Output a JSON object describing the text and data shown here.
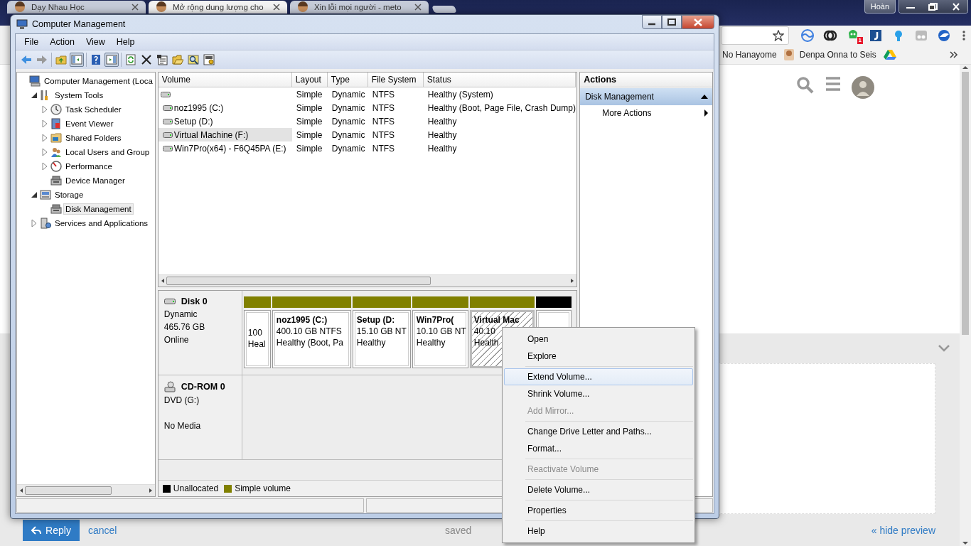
{
  "browser": {
    "tabs": [
      {
        "title": "Dạy Nhau Học",
        "selected": false
      },
      {
        "title": "Mở rộng dung lượng cho",
        "selected": true
      },
      {
        "title": "Xin lỗi mọi người - meto",
        "selected": false
      }
    ],
    "profile": "Hoàn",
    "extensions": [
      {
        "kind": "wave"
      },
      {
        "kind": "rings"
      },
      {
        "kind": "alien",
        "badge": "1"
      },
      {
        "kind": "bookmark"
      },
      {
        "kind": "bulb"
      },
      {
        "kind": "glasses"
      },
      {
        "kind": "globe"
      }
    ],
    "bookmarks": [
      {
        "kind": "text",
        "label": "No Hanayome"
      },
      {
        "kind": "image",
        "label": "Denpa Onna to Seis"
      },
      {
        "kind": "drive"
      }
    ],
    "page": {
      "reply_button": "Reply",
      "cancel_link": "cancel",
      "save_status": "saved",
      "hide_preview_link": "« hide preview"
    }
  },
  "window": {
    "title": "Computer Management",
    "menu": [
      "File",
      "Action",
      "View",
      "Help"
    ],
    "toolbar": [
      [
        {
          "kind": "back",
          "pressed": false
        },
        {
          "kind": "forward",
          "pressed": false
        }
      ],
      [
        {
          "kind": "up",
          "pressed": false
        },
        {
          "kind": "tree",
          "pressed": true
        }
      ],
      [
        {
          "kind": "help",
          "pressed": false
        },
        {
          "kind": "pane",
          "pressed": true
        }
      ],
      [
        {
          "kind": "refresh",
          "pressed": false
        },
        {
          "kind": "delete",
          "pressed": false
        },
        {
          "kind": "properties",
          "pressed": false
        },
        {
          "kind": "open",
          "pressed": false
        },
        {
          "kind": "search",
          "pressed": false
        },
        {
          "kind": "settings",
          "pressed": false
        }
      ]
    ],
    "tree": [
      {
        "label": "Computer Management (Loca",
        "kind": "computer",
        "selected": false,
        "children": [
          {
            "label": "System Tools",
            "kind": "tools",
            "expanded": true,
            "selected": false,
            "children": [
              {
                "label": "Task Scheduler",
                "kind": "clock",
                "expanded": false,
                "selected": false
              },
              {
                "label": "Event Viewer",
                "kind": "viewer",
                "expanded": false,
                "selected": false
              },
              {
                "label": "Shared Folders",
                "kind": "folder",
                "expanded": false,
                "selected": false
              },
              {
                "label": "Local Users and Group",
                "kind": "users",
                "expanded": false,
                "selected": false
              },
              {
                "label": "Performance",
                "kind": "gauge",
                "expanded": false,
                "selected": false
              },
              {
                "label": "Device Manager",
                "kind": "device",
                "selected": false
              }
            ]
          },
          {
            "label": "Storage",
            "kind": "storage",
            "expanded": true,
            "selected": false,
            "children": [
              {
                "label": "Disk Management",
                "kind": "device",
                "selected": true
              }
            ]
          },
          {
            "label": "Services and Applications",
            "kind": "services",
            "expanded": false,
            "selected": false
          }
        ]
      }
    ],
    "volumes": {
      "columns": [
        "Volume",
        "Layout",
        "Type",
        "File System",
        "Status"
      ],
      "rows": [
        {
          "layout": "Simple",
          "type": "Dynamic",
          "file_system": "NTFS",
          "status": "Healthy (System)",
          "selected": false
        },
        {
          "volume": "noz1995 (C:)",
          "layout": "Simple",
          "type": "Dynamic",
          "file_system": "NTFS",
          "status": "Healthy (Boot, Page File, Crash Dump)",
          "selected": false
        },
        {
          "volume": "Setup (D:)",
          "layout": "Simple",
          "type": "Dynamic",
          "file_system": "NTFS",
          "status": "Healthy",
          "selected": false
        },
        {
          "volume": "Virtual Machine (F:)",
          "layout": "Simple",
          "type": "Dynamic",
          "file_system": "NTFS",
          "status": "Healthy",
          "selected": true
        },
        {
          "volume": "Win7Pro(x64) - F6Q45PA (E:)",
          "layout": "Simple",
          "type": "Dynamic",
          "file_system": "NTFS",
          "status": "Healthy",
          "selected": false
        }
      ]
    },
    "disks": [
      {
        "kind": "disk",
        "name": "Disk 0",
        "lines": [
          "Dynamic",
          "465.76 GB",
          "Online"
        ],
        "partitions": [
          {
            "kind": "simple",
            "size": "100",
            "status": "Heal",
            "selected": false
          },
          {
            "kind": "simple",
            "name": "noz1995  (C:)",
            "size": "400.10 GB NTFS",
            "status": "Healthy (Boot, Pa",
            "selected": false
          },
          {
            "kind": "simple",
            "name": "Setup  (D:",
            "size": "15.10 GB NT",
            "status": "Healthy",
            "selected": false
          },
          {
            "kind": "simple",
            "name": "Win7Pro(",
            "size": "10.10 GB NT",
            "status": "Healthy",
            "selected": false
          },
          {
            "kind": "simple",
            "name": "Virtual Mac",
            "size": "40.10",
            "status": "Health",
            "selected": true
          },
          {
            "kind": "unallocated",
            "selected": false
          }
        ]
      },
      {
        "kind": "cdrom",
        "name": "CD-ROM 0",
        "lines": [
          "DVD (G:)",
          "No Media"
        ]
      }
    ],
    "legend": [
      {
        "label": "Unallocated",
        "color": "#000000"
      },
      {
        "label": "Simple volume",
        "color": "#808000"
      }
    ],
    "actions": {
      "title": "Actions",
      "section": "Disk Management",
      "items": [
        "More Actions"
      ]
    }
  },
  "context_menu": [
    [
      {
        "label": "Open",
        "disabled": false,
        "selected": false
      },
      {
        "label": "Explore",
        "disabled": false,
        "selected": false
      }
    ],
    [
      {
        "label": "Extend Volume...",
        "disabled": false,
        "selected": true
      },
      {
        "label": "Shrink Volume...",
        "disabled": false,
        "selected": false
      },
      {
        "label": "Add Mirror...",
        "disabled": true,
        "selected": false
      }
    ],
    [
      {
        "label": "Change Drive Letter and Paths...",
        "disabled": false,
        "selected": false
      },
      {
        "label": "Format...",
        "disabled": false,
        "selected": false
      }
    ],
    [
      {
        "label": "Reactivate Volume",
        "disabled": true,
        "selected": false
      }
    ],
    [
      {
        "label": "Delete Volume...",
        "disabled": false,
        "selected": false
      }
    ],
    [
      {
        "label": "Properties",
        "disabled": false,
        "selected": false
      }
    ],
    [
      {
        "label": "Help",
        "disabled": false,
        "selected": false
      }
    ]
  ]
}
